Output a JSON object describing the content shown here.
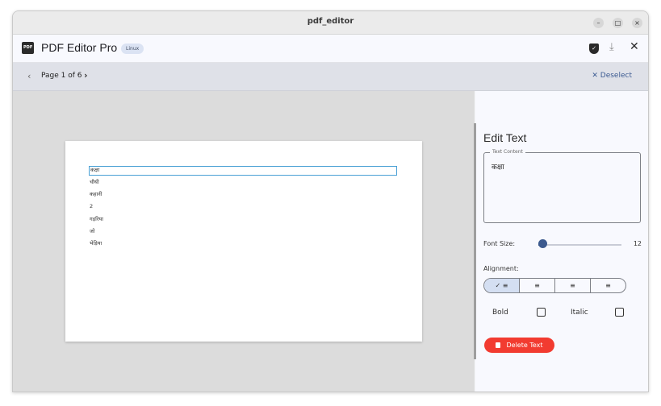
{
  "window": {
    "title": "pdf_editor",
    "buttons": {
      "minimize": "–",
      "maximize": "□",
      "close": "×"
    }
  },
  "appbar": {
    "title": "PDF Editor Pro",
    "badge": "Linux",
    "icons": {
      "shield": "shield-icon",
      "download": "download-icon",
      "close": "close-icon"
    },
    "shield_glyph": "✓",
    "download_glyph": "⤓",
    "close_glyph": "✕"
  },
  "navbar": {
    "prev_glyph": "‹",
    "page_label": "Page 1 of 6",
    "next_glyph": "›",
    "deselect": "✕  Deselect"
  },
  "document": {
    "lines": [
      "कक्षा",
      "चौथी",
      "कहानी",
      "2",
      "गड़रिया",
      "जो",
      "भेड़िया"
    ],
    "selected_index": 0
  },
  "panel": {
    "title": "Edit Text",
    "content_label": "Text Content",
    "content_value": "कक्षा",
    "font_size_label": "Font Size:",
    "font_size_value": "12",
    "font_size_fraction": 0.05,
    "alignment_label": "Alignment:",
    "alignment": [
      {
        "label": "✓ ≡",
        "name": "align-left-icon",
        "selected": true
      },
      {
        "label": "≡",
        "name": "align-center-icon",
        "selected": false
      },
      {
        "label": "≡",
        "name": "align-right-icon",
        "selected": false
      },
      {
        "label": "≡",
        "name": "align-justify-icon",
        "selected": false
      }
    ],
    "bold_label": "Bold",
    "italic_label": "Italic",
    "bold_checked": false,
    "italic_checked": false,
    "delete_label": "Delete Text"
  },
  "colors": {
    "accent": "#3c5a8e",
    "selection": "#4aa0d5",
    "delete": "#f23b30"
  }
}
